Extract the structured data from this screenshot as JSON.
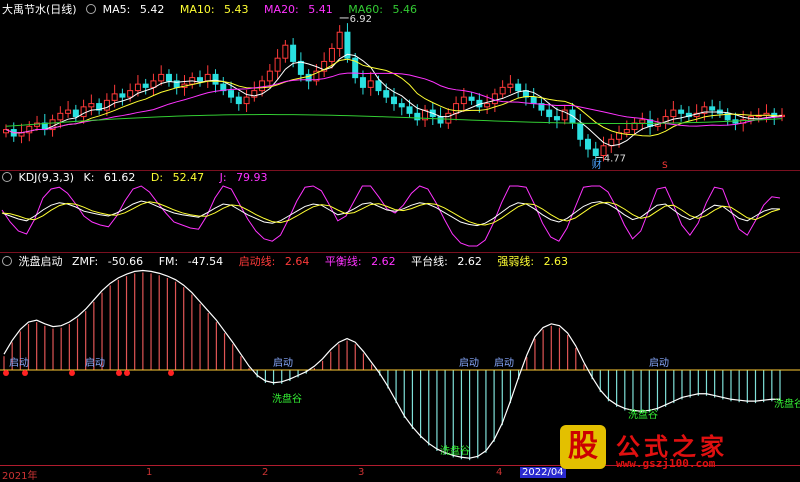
{
  "price_header": {
    "stock": "大禹节水(日线)",
    "ma5_label": "MA5:",
    "ma5": "5.42",
    "ma10_label": "MA10:",
    "ma10": "5.43",
    "ma20_label": "MA20:",
    "ma20": "5.41",
    "ma60_label": "MA60:",
    "ma60": "5.46"
  },
  "price_annotations": {
    "high": "6.92",
    "low": "4.77",
    "marker_cai": "财",
    "marker_s": "S"
  },
  "kdj_header": {
    "name": "KDJ(9,3,3)",
    "k_label": "K:",
    "k": "61.62",
    "d_label": "D:",
    "d": "52.47",
    "j_label": "J:",
    "j": "79.93"
  },
  "wash_header": {
    "name": "洗盘启动",
    "zmf_label": "ZMF:",
    "zmf": "-50.66",
    "fm_label": "FM:",
    "fm": "-47.54",
    "qd_label": "启动线:",
    "qd": "2.64",
    "ph_label": "平衡线:",
    "ph": "2.62",
    "pt_label": "平台线:",
    "pt": "2.62",
    "qr_label": "强弱线:",
    "qr": "2.63"
  },
  "wash_signals": {
    "qidong": "启动",
    "xipangu": "洗盘谷"
  },
  "time_axis": {
    "t0": "2021年",
    "t1": "1",
    "t2": "2",
    "t3": "3",
    "t4": "4",
    "t5": "2022/04"
  },
  "watermark": {
    "badge": "股",
    "name": "公式之家",
    "url": "www.gszj100.com"
  },
  "colors": {
    "up": "#ff3a3a",
    "down": "#2ae0e0",
    "ma5": "#ffffff",
    "ma10": "#ffff33",
    "ma20": "#ff33ff",
    "ma60": "#33cc33",
    "k": "#ffffff",
    "d": "#ffff33",
    "j": "#ff33ff"
  },
  "series": {
    "close": [
      5.2,
      5.1,
      5.15,
      5.25,
      5.3,
      5.2,
      5.35,
      5.45,
      5.5,
      5.4,
      5.55,
      5.6,
      5.5,
      5.65,
      5.75,
      5.7,
      5.8,
      5.9,
      5.85,
      5.95,
      6.05,
      5.95,
      5.85,
      5.9,
      6.0,
      5.95,
      6.05,
      5.9,
      5.8,
      5.7,
      5.6,
      5.7,
      5.8,
      5.95,
      6.1,
      6.3,
      6.5,
      6.25,
      6.05,
      5.95,
      6.1,
      6.25,
      6.45,
      6.7,
      6.3,
      6.0,
      5.85,
      5.95,
      5.8,
      5.7,
      5.6,
      5.55,
      5.45,
      5.35,
      5.5,
      5.4,
      5.3,
      5.45,
      5.6,
      5.7,
      5.65,
      5.55,
      5.6,
      5.75,
      5.85,
      5.9,
      5.8,
      5.7,
      5.6,
      5.5,
      5.4,
      5.35,
      5.5,
      5.3,
      5.05,
      4.9,
      4.8,
      4.95,
      5.05,
      5.15,
      5.2,
      5.3,
      5.35,
      5.25,
      5.3,
      5.4,
      5.5,
      5.45,
      5.4,
      5.45,
      5.55,
      5.5,
      5.45,
      5.35,
      5.3,
      5.35,
      5.4,
      5.42,
      5.45,
      5.4,
      5.42
    ],
    "kdj_k": [
      55,
      50,
      45,
      42,
      50,
      60,
      68,
      72,
      70,
      65,
      58,
      55,
      52,
      50,
      55,
      62,
      70,
      75,
      72,
      66,
      60,
      55,
      52,
      50,
      48,
      55,
      63,
      70,
      68,
      60,
      52,
      46,
      40,
      38,
      42,
      50,
      58,
      66,
      70,
      68,
      60,
      52,
      55,
      62,
      70,
      72,
      66,
      60,
      58,
      62,
      68,
      72,
      70,
      64,
      56,
      48,
      40,
      36,
      34,
      38,
      46,
      56,
      66,
      72,
      70,
      62,
      52,
      44,
      40,
      46,
      56,
      66,
      72,
      74,
      70,
      62,
      52,
      44,
      48,
      58,
      68,
      70,
      60,
      50,
      44,
      50,
      60,
      68,
      66,
      56,
      46,
      42,
      50,
      58,
      62,
      61.62
    ],
    "kdj_j": [
      60,
      40,
      25,
      20,
      45,
      80,
      95,
      98,
      88,
      70,
      50,
      40,
      35,
      32,
      50,
      75,
      95,
      100,
      90,
      72,
      55,
      40,
      35,
      30,
      28,
      50,
      80,
      100,
      95,
      70,
      45,
      25,
      12,
      8,
      18,
      45,
      75,
      98,
      100,
      92,
      68,
      42,
      50,
      75,
      100,
      100,
      82,
      62,
      55,
      68,
      88,
      100,
      95,
      72,
      45,
      20,
      5,
      0,
      0,
      10,
      38,
      72,
      100,
      100,
      98,
      70,
      38,
      15,
      8,
      30,
      65,
      98,
      100,
      100,
      90,
      65,
      35,
      12,
      25,
      60,
      95,
      98,
      68,
      35,
      18,
      38,
      72,
      98,
      95,
      60,
      28,
      18,
      42,
      68,
      82,
      79.93
    ],
    "wash": [
      15,
      30,
      42,
      50,
      52,
      48,
      45,
      46,
      50,
      56,
      64,
      74,
      84,
      92,
      98,
      102,
      105,
      106,
      105,
      103,
      100,
      96,
      90,
      82,
      72,
      62,
      52,
      40,
      28,
      15,
      2,
      -8,
      -14,
      -16,
      -15,
      -12,
      -8,
      -4,
      2,
      10,
      20,
      28,
      32,
      28,
      18,
      6,
      -6,
      -20,
      -36,
      -52,
      -64,
      -74,
      -82,
      -88,
      -92,
      -95,
      -97,
      -98,
      -96,
      -90,
      -78,
      -60,
      -36,
      -10,
      14,
      34,
      44,
      48,
      46,
      38,
      24,
      6,
      -10,
      -24,
      -34,
      -40,
      -44,
      -46,
      -47,
      -46,
      -44,
      -40,
      -36,
      -32,
      -30,
      -28,
      -28,
      -30,
      -32,
      -34,
      -35,
      -36,
      -36,
      -35,
      -34,
      -34
    ]
  }
}
